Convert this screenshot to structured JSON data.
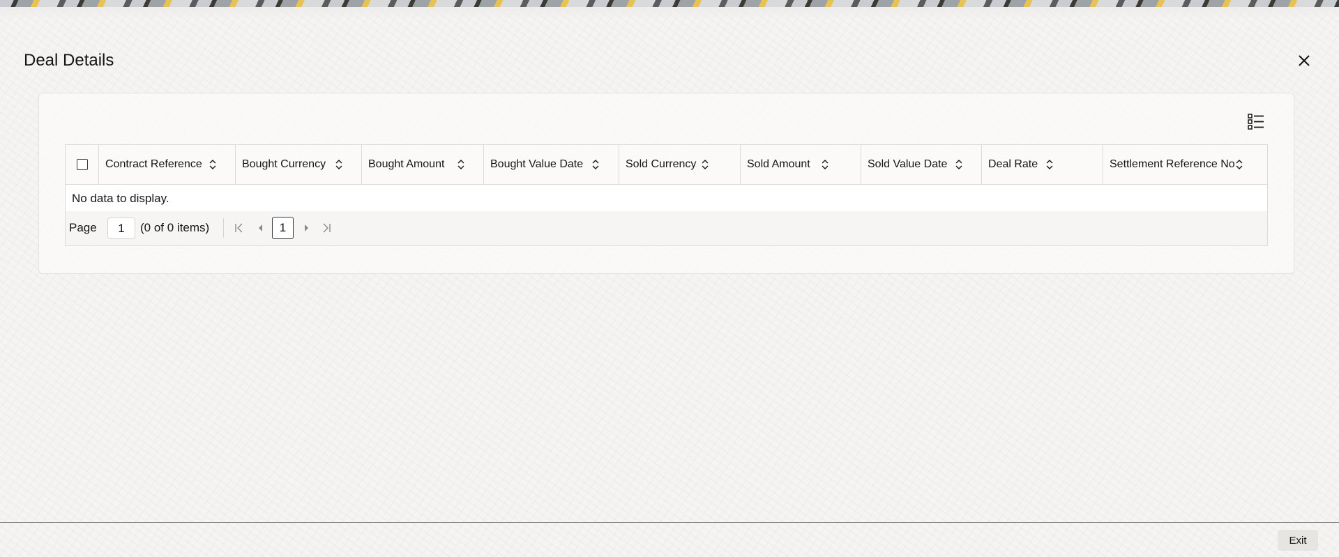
{
  "dialog": {
    "title": "Deal Details",
    "close_icon": "close-icon"
  },
  "toolbar": {
    "columns_icon": "column-list-icon"
  },
  "grid": {
    "columns": [
      "Contract Reference",
      "Bought Currency",
      "Bought Amount",
      "Bought Value Date",
      "Sold Currency",
      "Sold Amount",
      "Sold Value Date",
      "Deal Rate",
      "Settlement Reference No"
    ],
    "sort_icon": "sort-icon",
    "empty_message": "No data to display."
  },
  "pagination": {
    "page_label": "Page",
    "page_input_value": "1",
    "items_summary": "(0 of 0 items)",
    "current_page": "1"
  },
  "footer": {
    "exit_label": "Exit"
  },
  "colors": {
    "background": "#f5f4f2",
    "text": "#161513",
    "border": "#dcdad7",
    "exit_button": "#e7e5e2"
  }
}
